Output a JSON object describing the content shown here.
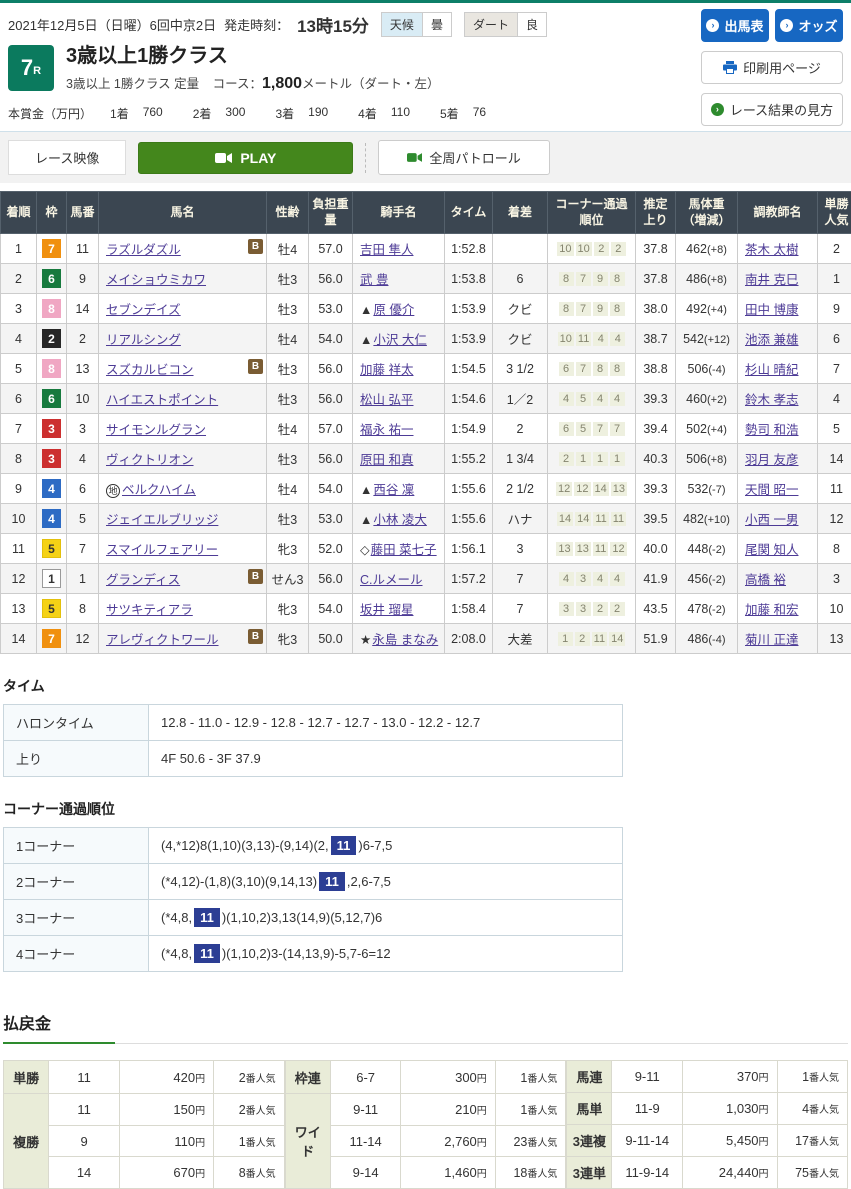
{
  "page": {
    "date_line": "2021年12月5日（日曜）6回中京2日",
    "start_label": "発走時刻：",
    "start_time": "13時15分",
    "weather": {
      "label": "天候",
      "value": "曇"
    },
    "track": {
      "label": "ダート",
      "value": "良"
    },
    "buttons": {
      "entries": "出馬表",
      "odds": "オッズ",
      "print": "印刷用ページ",
      "guide": "レース結果の見方"
    }
  },
  "race": {
    "number": "7",
    "number_suffix": "R",
    "title": "3歳以上1勝クラス",
    "conditions": "3歳以上 1勝クラス 定量",
    "course_label": "コース：",
    "course_value": "1,800",
    "course_unit": "メートル（ダート・左）"
  },
  "prize": {
    "label": "本賞金（万円）",
    "items": [
      {
        "place": "1着",
        "amount": "760"
      },
      {
        "place": "2着",
        "amount": "300"
      },
      {
        "place": "3着",
        "amount": "190"
      },
      {
        "place": "4着",
        "amount": "110"
      },
      {
        "place": "5着",
        "amount": "76"
      }
    ]
  },
  "video": {
    "race_video": "レース映像",
    "play": "PLAY",
    "patrol": "全周パトロール"
  },
  "frame_colors": {
    "1": {
      "bg": "#ffffff",
      "fg": "#333333",
      "border": "#999999"
    },
    "2": {
      "bg": "#272727",
      "fg": "#ffffff",
      "border": "#272727"
    },
    "3": {
      "bg": "#cc2f2f",
      "fg": "#ffffff",
      "border": "#cc2f2f"
    },
    "4": {
      "bg": "#2d6bc4",
      "fg": "#ffffff",
      "border": "#2d6bc4"
    },
    "5": {
      "bg": "#f5d216",
      "fg": "#333333",
      "border": "#e3c00c"
    },
    "6": {
      "bg": "#177a3e",
      "fg": "#ffffff",
      "border": "#177a3e"
    },
    "7": {
      "bg": "#f0900f",
      "fg": "#ffffff",
      "border": "#f0900f"
    },
    "8": {
      "bg": "#f0a7c3",
      "fg": "#ffffff",
      "border": "#f0a7c3"
    }
  },
  "results": {
    "b_badge": "B",
    "headers": [
      "着順",
      "枠",
      "馬番",
      "馬名",
      "性齢",
      "負担重量",
      "騎手名",
      "タイム",
      "着差",
      "コーナー通過順位",
      "推定上り",
      "馬体重（増減）",
      "調教師名",
      "単勝人気"
    ],
    "rows": [
      {
        "pos": "1",
        "frame": "7",
        "num": "11",
        "horse": "ラズルダズル",
        "b": true,
        "horse_mark": "",
        "sex_age": "牡4",
        "weight": "57.0",
        "jockey_mark": "",
        "jockey": "吉田 隼人",
        "time": "1:52.8",
        "margin": "",
        "corners": [
          "10",
          "10",
          "2",
          "2"
        ],
        "last3f": "37.8",
        "bw": "462",
        "bw_diff": "(+8)",
        "trainer": "茶木 太樹",
        "fav": "2"
      },
      {
        "pos": "2",
        "frame": "6",
        "num": "9",
        "horse": "メイショウミカワ",
        "b": false,
        "horse_mark": "",
        "sex_age": "牡3",
        "weight": "56.0",
        "jockey_mark": "",
        "jockey": "武 豊",
        "time": "1:53.8",
        "margin": "6",
        "corners": [
          "8",
          "7",
          "9",
          "8"
        ],
        "last3f": "37.8",
        "bw": "486",
        "bw_diff": "(+8)",
        "trainer": "南井 克巳",
        "fav": "1"
      },
      {
        "pos": "3",
        "frame": "8",
        "num": "14",
        "horse": "セブンデイズ",
        "b": false,
        "horse_mark": "",
        "sex_age": "牡3",
        "weight": "53.0",
        "jockey_mark": "▲",
        "jockey": "原 優介",
        "time": "1:53.9",
        "margin": "クビ",
        "corners": [
          "8",
          "7",
          "9",
          "8"
        ],
        "last3f": "38.0",
        "bw": "492",
        "bw_diff": "(+4)",
        "trainer": "田中 博康",
        "fav": "9"
      },
      {
        "pos": "4",
        "frame": "2",
        "num": "2",
        "horse": "リアルシング",
        "b": false,
        "horse_mark": "",
        "sex_age": "牡4",
        "weight": "54.0",
        "jockey_mark": "▲",
        "jockey": "小沢 大仁",
        "time": "1:53.9",
        "margin": "クビ",
        "corners": [
          "10",
          "11",
          "4",
          "4"
        ],
        "last3f": "38.7",
        "bw": "542",
        "bw_diff": "(+12)",
        "trainer": "池添 兼雄",
        "fav": "6"
      },
      {
        "pos": "5",
        "frame": "8",
        "num": "13",
        "horse": "スズカルビコン",
        "b": true,
        "horse_mark": "",
        "sex_age": "牡3",
        "weight": "56.0",
        "jockey_mark": "",
        "jockey": "加藤 祥太",
        "time": "1:54.5",
        "margin": "3 1/2",
        "corners": [
          "6",
          "7",
          "8",
          "8"
        ],
        "last3f": "38.8",
        "bw": "506",
        "bw_diff": "(-4)",
        "trainer": "杉山 晴紀",
        "fav": "7"
      },
      {
        "pos": "6",
        "frame": "6",
        "num": "10",
        "horse": "ハイエストポイント",
        "b": false,
        "horse_mark": "",
        "sex_age": "牡3",
        "weight": "56.0",
        "jockey_mark": "",
        "jockey": "松山 弘平",
        "time": "1:54.6",
        "margin": "1／2",
        "corners": [
          "4",
          "5",
          "4",
          "4"
        ],
        "last3f": "39.3",
        "bw": "460",
        "bw_diff": "(+2)",
        "trainer": "鈴木 孝志",
        "fav": "4"
      },
      {
        "pos": "7",
        "frame": "3",
        "num": "3",
        "horse": "サイモンルグラン",
        "b": false,
        "horse_mark": "",
        "sex_age": "牡4",
        "weight": "57.0",
        "jockey_mark": "",
        "jockey": "福永 祐一",
        "time": "1:54.9",
        "margin": "2",
        "corners": [
          "6",
          "5",
          "7",
          "7"
        ],
        "last3f": "39.4",
        "bw": "502",
        "bw_diff": "(+4)",
        "trainer": "勢司 和浩",
        "fav": "5"
      },
      {
        "pos": "8",
        "frame": "3",
        "num": "4",
        "horse": "ヴィクトリオン",
        "b": false,
        "horse_mark": "",
        "sex_age": "牡3",
        "weight": "56.0",
        "jockey_mark": "",
        "jockey": "原田 和真",
        "time": "1:55.2",
        "margin": "1 3/4",
        "corners": [
          "2",
          "1",
          "1",
          "1"
        ],
        "last3f": "40.3",
        "bw": "506",
        "bw_diff": "(+8)",
        "trainer": "羽月 友彦",
        "fav": "14"
      },
      {
        "pos": "9",
        "frame": "4",
        "num": "6",
        "horse": "ベルクハイム",
        "b": false,
        "horse_mark": "地",
        "sex_age": "牡4",
        "weight": "54.0",
        "jockey_mark": "▲",
        "jockey": "西谷 凜",
        "time": "1:55.6",
        "margin": "2 1/2",
        "corners": [
          "12",
          "12",
          "14",
          "13"
        ],
        "last3f": "39.3",
        "bw": "532",
        "bw_diff": "(-7)",
        "trainer": "天間 昭一",
        "fav": "11"
      },
      {
        "pos": "10",
        "frame": "4",
        "num": "5",
        "horse": "ジェイエルブリッジ",
        "b": false,
        "horse_mark": "",
        "sex_age": "牡3",
        "weight": "53.0",
        "jockey_mark": "▲",
        "jockey": "小林 凌大",
        "time": "1:55.6",
        "margin": "ハナ",
        "corners": [
          "14",
          "14",
          "11",
          "11"
        ],
        "last3f": "39.5",
        "bw": "482",
        "bw_diff": "(+10)",
        "trainer": "小西 一男",
        "fav": "12"
      },
      {
        "pos": "11",
        "frame": "5",
        "num": "7",
        "horse": "スマイルフェアリー",
        "b": false,
        "horse_mark": "",
        "sex_age": "牝3",
        "weight": "52.0",
        "jockey_mark": "◇",
        "jockey": "藤田 菜七子",
        "time": "1:56.1",
        "margin": "3",
        "corners": [
          "13",
          "13",
          "11",
          "12"
        ],
        "last3f": "40.0",
        "bw": "448",
        "bw_diff": "(-2)",
        "trainer": "尾関 知人",
        "fav": "8"
      },
      {
        "pos": "12",
        "frame": "1",
        "num": "1",
        "horse": "グランディス",
        "b": true,
        "horse_mark": "",
        "sex_age": "せん3",
        "weight": "56.0",
        "jockey_mark": "",
        "jockey": "C.ルメール",
        "time": "1:57.2",
        "margin": "7",
        "corners": [
          "4",
          "3",
          "4",
          "4"
        ],
        "last3f": "41.9",
        "bw": "456",
        "bw_diff": "(-2)",
        "trainer": "高橋 裕",
        "fav": "3"
      },
      {
        "pos": "13",
        "frame": "5",
        "num": "8",
        "horse": "サツキティアラ",
        "b": false,
        "horse_mark": "",
        "sex_age": "牝3",
        "weight": "54.0",
        "jockey_mark": "",
        "jockey": "坂井 瑠星",
        "time": "1:58.4",
        "margin": "7",
        "corners": [
          "3",
          "3",
          "2",
          "2"
        ],
        "last3f": "43.5",
        "bw": "478",
        "bw_diff": "(-2)",
        "trainer": "加藤 和宏",
        "fav": "10"
      },
      {
        "pos": "14",
        "frame": "7",
        "num": "12",
        "horse": "アレヴィクトワール",
        "b": true,
        "horse_mark": "",
        "sex_age": "牝3",
        "weight": "50.0",
        "jockey_mark": "★",
        "jockey": "永島 まなみ",
        "time": "2:08.0",
        "margin": "大差",
        "corners": [
          "1",
          "2",
          "11",
          "14"
        ],
        "last3f": "51.9",
        "bw": "486",
        "bw_diff": "(-4)",
        "trainer": "菊川 正達",
        "fav": "13"
      }
    ]
  },
  "time_section": {
    "title": "タイム",
    "rows": [
      {
        "label": "ハロンタイム",
        "value": "12.8 - 11.0 - 12.9 - 12.8 - 12.7 - 12.7 - 13.0 - 12.2 - 12.7"
      },
      {
        "label": "上り",
        "value": "4F 50.6 - 3F 37.9"
      }
    ]
  },
  "corner_section": {
    "title": "コーナー通過順位",
    "rows": [
      {
        "label": "1コーナー",
        "pre": "(4,*12)8(1,10)(3,13)-(9,14)(2,",
        "hl": "11",
        "post": ")6-7,5"
      },
      {
        "label": "2コーナー",
        "pre": "(*4,12)-(1,8)(3,10)(9,14,13)",
        "hl": "11",
        "post": ",2,6-7,5"
      },
      {
        "label": "3コーナー",
        "pre": "(*4,8,",
        "hl": "11",
        "post": ")(1,10,2)3,13(14,9)(5,12,7)6"
      },
      {
        "label": "4コーナー",
        "pre": "(*4,8,",
        "hl": "11",
        "post": ")(1,10,2)3-(14,13,9)-5,7-6=12"
      }
    ]
  },
  "payout": {
    "title": "払戻金",
    "yen_suffix": "円",
    "fav_suffix": "番人気",
    "groups": [
      [
        {
          "label": "単勝",
          "rows": [
            {
              "num": "11",
              "pay": "420",
              "fav": "2"
            }
          ]
        },
        {
          "label": "複勝",
          "rows": [
            {
              "num": "11",
              "pay": "150",
              "fav": "2"
            },
            {
              "num": "9",
              "pay": "110",
              "fav": "1"
            },
            {
              "num": "14",
              "pay": "670",
              "fav": "8"
            }
          ]
        }
      ],
      [
        {
          "label": "枠連",
          "rows": [
            {
              "num": "6-7",
              "pay": "300",
              "fav": "1"
            }
          ]
        },
        {
          "label": "ワイド",
          "rows": [
            {
              "num": "9-11",
              "pay": "210",
              "fav": "1"
            },
            {
              "num": "11-14",
              "pay": "2,760",
              "fav": "23"
            },
            {
              "num": "9-14",
              "pay": "1,460",
              "fav": "18"
            }
          ]
        }
      ],
      [
        {
          "label": "馬連",
          "rows": [
            {
              "num": "9-11",
              "pay": "370",
              "fav": "1"
            }
          ]
        },
        {
          "label": "馬単",
          "rows": [
            {
              "num": "11-9",
              "pay": "1,030",
              "fav": "4"
            }
          ]
        },
        {
          "label": "3連複",
          "rows": [
            {
              "num": "9-11-14",
              "pay": "5,450",
              "fav": "17"
            }
          ]
        },
        {
          "label": "3連単",
          "rows": [
            {
              "num": "11-9-14",
              "pay": "24,440",
              "fav": "75"
            }
          ]
        }
      ]
    ]
  }
}
